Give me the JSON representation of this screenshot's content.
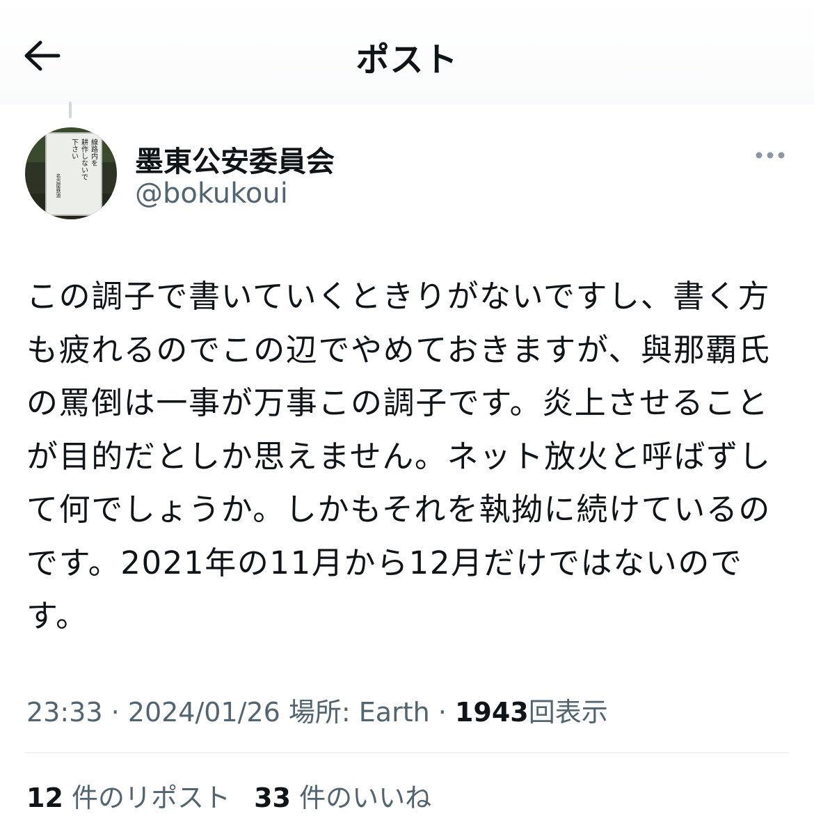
{
  "header": {
    "title": "ポスト",
    "back_icon": "arrow-left-icon"
  },
  "author": {
    "display_name": "墨東公安委員会",
    "handle": "@bokukoui",
    "avatar_sign_lines": [
      "線路内を",
      "耕作しないで",
      "下さい"
    ],
    "avatar_sign_footer": "名古屋鉄道"
  },
  "more_icon": "more-horizontal-icon",
  "tweet": {
    "lines": [
      "この調子で書いていくときりがないですし、書く方",
      "も疲れるのでこの辺でやめておきますが、與那覇氏",
      "の罵倒は一事が万事この調子です。炎上させること",
      "が目的だとしか思えません。ネット放火と呼ばずし",
      "て何でしょうか。しかもそれを執拗に続けているの",
      "です。2021年の11月から12月だけではないので",
      "す。"
    ]
  },
  "meta": {
    "time": "23:33",
    "sep1": " · ",
    "date": "2024/01/26",
    "location": "場所: Earth",
    "sep2": " · ",
    "views": "1943",
    "views_label": "回表示"
  },
  "stats": {
    "reposts_count": "12",
    "reposts_label": "件のリポスト",
    "likes_count": "33",
    "likes_label": "件のいいね"
  },
  "colors": {
    "text": "#0f1419",
    "secondary": "#536471",
    "divider": "#eff3f4"
  }
}
